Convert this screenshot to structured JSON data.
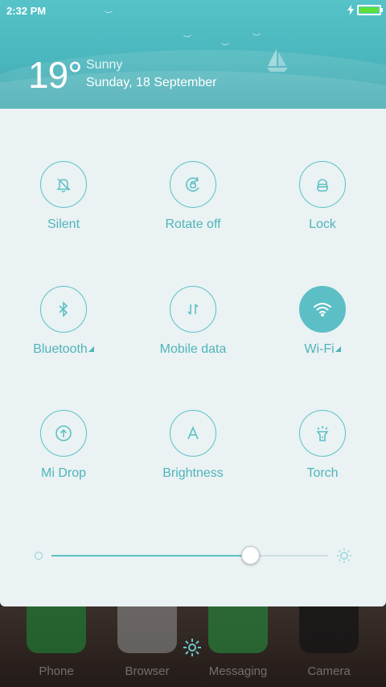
{
  "status_bar": {
    "time": "2:32 PM"
  },
  "weather": {
    "temperature": "19°",
    "condition": "Sunny",
    "date": "Sunday, 18 September"
  },
  "toggles": [
    {
      "label": "Silent",
      "icon": "bell-off-icon",
      "on": false
    },
    {
      "label": "Rotate off",
      "icon": "rotate-lock-icon",
      "on": false
    },
    {
      "label": "Lock",
      "icon": "lock-icon",
      "on": false
    },
    {
      "label": "Bluetooth",
      "icon": "bluetooth-icon",
      "on": false,
      "expand": true
    },
    {
      "label": "Mobile data",
      "icon": "mobile-data-icon",
      "on": false
    },
    {
      "label": "Wi-Fi",
      "icon": "wifi-icon",
      "on": true,
      "expand": true
    },
    {
      "label": "Mi Drop",
      "icon": "mi-drop-icon",
      "on": false
    },
    {
      "label": "Brightness",
      "icon": "auto-brightness-icon",
      "on": false
    },
    {
      "label": "Torch",
      "icon": "torch-icon",
      "on": false
    }
  ],
  "brightness": {
    "level": 0.72
  },
  "dock": [
    {
      "label": "Phone",
      "color": "#2fa84a"
    },
    {
      "label": "Browser",
      "color": "#e8e8e8"
    },
    {
      "label": "Messaging",
      "color": "#3cb454"
    },
    {
      "label": "Camera",
      "color": "#2a2a2a"
    }
  ],
  "colors": {
    "accent": "#5cc1c6",
    "header": "#4ab6bd",
    "panel": "#eaf2f3"
  }
}
